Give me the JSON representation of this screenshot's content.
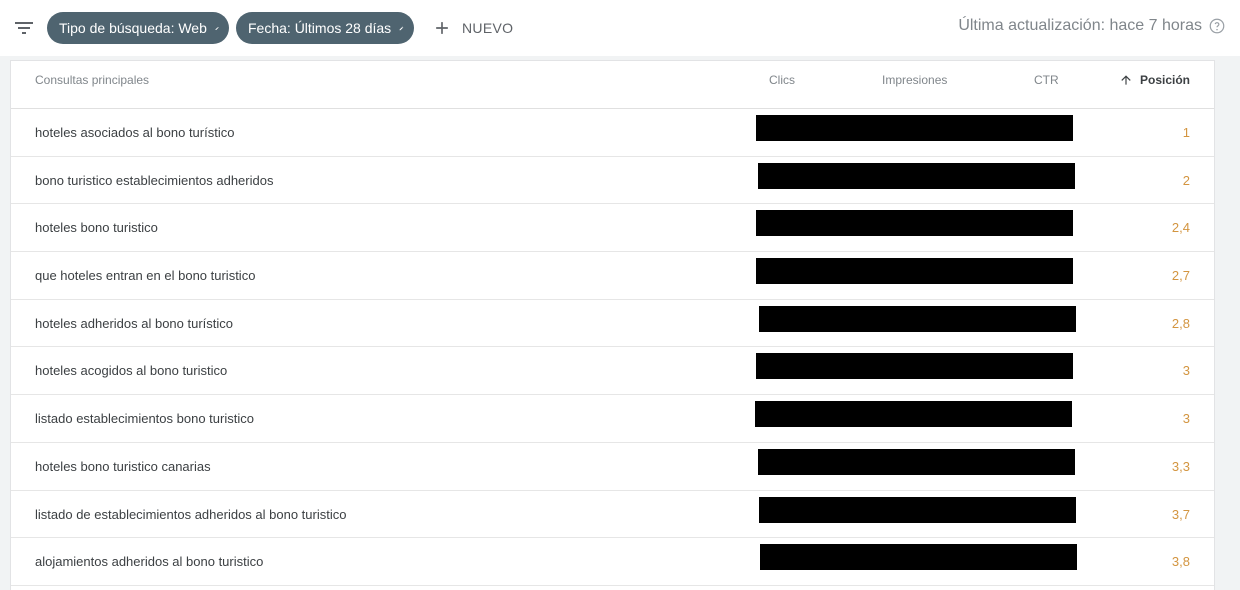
{
  "toolbar": {
    "filter_icon": "filter-list-icon",
    "chips": [
      {
        "label": "Tipo de búsqueda: Web",
        "icon": "edit-icon"
      },
      {
        "label": "Fecha: Últimos 28 días",
        "icon": "edit-icon"
      }
    ],
    "new_label": "NUEVO",
    "last_update": "Última actualización: hace 7 horas",
    "help_icon": "help-circle-icon"
  },
  "table": {
    "headers": {
      "query": "Consultas principales",
      "clicks": "Clics",
      "impressions": "Impresiones",
      "ctr": "CTR",
      "position": "Posición",
      "sort_icon": "arrow-up-icon"
    },
    "rows": [
      {
        "query": "hoteles asociados al bono turístico",
        "position": "1"
      },
      {
        "query": "bono turistico establecimientos adheridos",
        "position": "2"
      },
      {
        "query": "hoteles bono turistico",
        "position": "2,4"
      },
      {
        "query": "que hoteles entran en el bono turistico",
        "position": "2,7"
      },
      {
        "query": "hoteles adheridos al bono turístico",
        "position": "2,8"
      },
      {
        "query": "hoteles acogidos al bono turistico",
        "position": "3"
      },
      {
        "query": "listado establecimientos bono turistico",
        "position": "3"
      },
      {
        "query": "hoteles bono turistico canarias",
        "position": "3,3"
      },
      {
        "query": "listado de establecimientos adheridos al bono turistico",
        "position": "3,7"
      },
      {
        "query": "alojamientos adheridos al bono turistico",
        "position": "3,8"
      }
    ]
  },
  "colors": {
    "chip_bg": "#4f6470",
    "position_text": "#d39540",
    "redaction": "#000000"
  }
}
